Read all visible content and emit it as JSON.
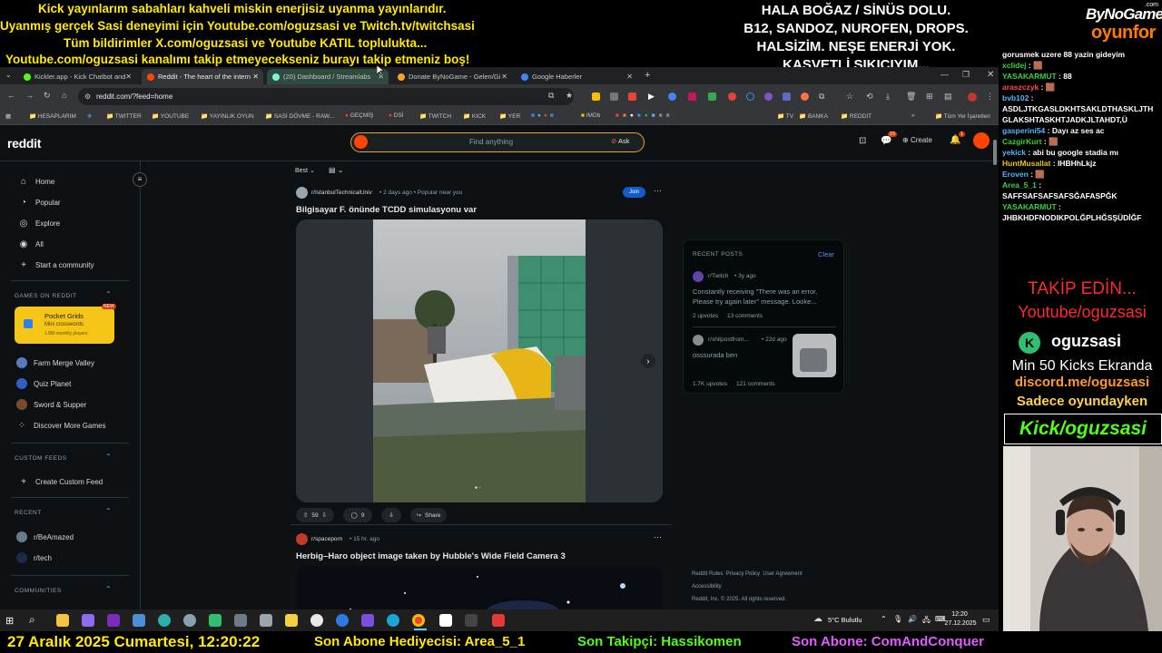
{
  "stream_overlay": {
    "top_lines": [
      "Kick yayınlarım sabahları kahveli miskin enerjisiz uyanma yayınlarıdır.",
      "Uyanmış gerçek Sasi deneyimi için Youtube.com/oguzsasi ve Twitch.tv/twitchsasi",
      "Tüm bildirimler X.com/oguzsasi ve Youtube KATIL toplulukta...",
      "Youtube.com/oguzsasi kanalımı takip etmeyecekseniz burayı takip etmeniz boş!"
    ],
    "status_lines": [
      "HALA BOĞAZ / SİNÜS DOLU.",
      "B12, SANDOZ, NUROFEN, DROPS.",
      "HALSİZİM. NEŞE ENERJİ YOK.",
      "KASVETLİ SIKICIYIM..."
    ],
    "logo_top": "ByNoGame",
    "logo_com": ".com",
    "logo_bottom": "oyunfor",
    "promo": {
      "follow": "TAKİP EDİN...",
      "youtube": "Youtube/oguzsasi",
      "kick_name": "oguzsasi",
      "min_kicks": "Min 50 Kicks Ekranda",
      "discord": "discord.me/oguzsasi",
      "only_game": "Sadece oyundayken",
      "kick_link": "Kick/oguzsasi"
    },
    "ticker": {
      "date": "27 Aralık 2025 Cumartesi, 12:20:22",
      "gift": "Son Abone Hediyecisi: Area_5_1",
      "follower": "Son Takipçi: Hassikomen",
      "subscriber": "Son Abone: ComAndConquer"
    }
  },
  "chat": [
    {
      "user": "",
      "text": "gorusmek uzere 88 yazin gideyim",
      "color": ""
    },
    {
      "user": "xclidej",
      "text": ": 🟫",
      "color": "g"
    },
    {
      "user": "YASAKARMUT",
      "text": ": 88",
      "color": "g"
    },
    {
      "user": "araszczyk",
      "text": ": 🟫",
      "color": "r"
    },
    {
      "user": "bvb102",
      "text": ":",
      "color": "b"
    },
    {
      "user": "",
      "text": "ASDLJTKGASLDKHTSAKLDTHASKLJTH",
      "color": ""
    },
    {
      "user": "",
      "text": "GLAKSHTASKHTJADKJLTAHDT,Ü",
      "color": ""
    },
    {
      "user": "gasperini54",
      "text": ": Dayı az ses ac",
      "color": "b"
    },
    {
      "user": "CazgirKurt",
      "text": ": 🟫",
      "color": "g"
    },
    {
      "user": "yekick",
      "text": ": abi bu google stadia mı",
      "color": "b"
    },
    {
      "user": "HuntMusallat",
      "text": ": IHBHhLkjz",
      "color": "y"
    },
    {
      "user": "Eroven",
      "text": ": 🟫",
      "color": "b"
    },
    {
      "user": "Area_5_1",
      "text": ":",
      "color": "g"
    },
    {
      "user": "",
      "text": "SAFFSAFSAFSAFSĞAFASPĞK",
      "color": ""
    },
    {
      "user": "YASAKARMUT",
      "text": ":",
      "color": "g"
    },
    {
      "user": "",
      "text": "JHBKHDFNODIKPOLĞPLHĞSŞÜDİĞF",
      "color": ""
    }
  ],
  "browser": {
    "tabs": [
      {
        "label": "Kickler.app - Kick Chatbot and",
        "color": "#53fc18"
      },
      {
        "label": "Reddit - The heart of the intern",
        "color": "#ff4500"
      },
      {
        "label": "(20) Dashboard / Streamlabs",
        "color": "#80f5d2"
      },
      {
        "label": "Donate ByNoGame - Gelen/Gi",
        "color": "#f5a623"
      },
      {
        "label": "Google Haberler",
        "color": "#4285f4"
      }
    ],
    "url": "reddit.com/?feed=home",
    "bookmarks": [
      "HESAPLARIM",
      "TWITTER",
      "YOUTUBE",
      "YAYINLIK OYUN",
      "SASİ DÖVME - RAW...",
      "GEÇMİŞ",
      "DSİ",
      "TWITCH",
      "KICK",
      "YER",
      "IMDb",
      "TV",
      "BANKA",
      "REDDIT"
    ],
    "all_bookmarks": "Tüm Yer İşaretleri"
  },
  "reddit": {
    "logo": "reddit",
    "search_placeholder": "Find anything",
    "ask": "Ask",
    "create": "Create",
    "chat_badge": "15",
    "notif_badge": "1",
    "nav": [
      {
        "label": "Home",
        "icon": "home-icon"
      },
      {
        "label": "Popular",
        "icon": "popular-icon"
      },
      {
        "label": "Explore",
        "icon": "explore-icon"
      },
      {
        "label": "All",
        "icon": "all-icon"
      },
      {
        "label": "Start a community",
        "icon": "plus-icon"
      }
    ],
    "games_header": "GAMES ON REDDIT",
    "featured_game": {
      "title": "Pocket Grids",
      "subtitle": "Mini crosswords",
      "players": "1.8M monthly players",
      "badge": "NEW"
    },
    "games": [
      "Farm Merge Valley",
      "Quiz Planet",
      "Sword & Supper",
      "Discover More Games"
    ],
    "custom_header": "CUSTOM FEEDS",
    "custom_item": "Create Custom Feed",
    "recent_header": "RECENT",
    "recent": [
      "r/BeAmazed",
      "r/tech"
    ],
    "communities_header": "COMMUNITIES",
    "sort": "Best",
    "posts": [
      {
        "subreddit": "r/IstanbulTechnicalUniv",
        "meta": "• 2 days ago • Popular near you",
        "title": "Bilgisayar F. önünde TCDD simulasyonu var",
        "join": "Join",
        "votes": "59",
        "comments": "9",
        "share": "Share"
      },
      {
        "subreddit": "r/spaceporn",
        "meta": "• 15 hr. ago",
        "title": "Herbig–Haro object image taken by Hubble's Wide Field Camera 3"
      }
    ],
    "recent_posts": {
      "header": "RECENT POSTS",
      "clear": "Clear",
      "items": [
        {
          "sub": "r/Twitch",
          "age": "• 3y ago",
          "title": "Constantly receiving \"There was an error. Please try again later\" message. Looke...",
          "upvotes": "2 upvotes",
          "comments": "13 comments"
        },
        {
          "sub": "r/shitpostfrom...",
          "age": "• 22d ago",
          "title": "osssurada ben",
          "upvotes": "1.7K upvotes",
          "comments": "121 comments"
        }
      ]
    },
    "footer": {
      "rules": "Reddit Rules",
      "privacy": "Privacy Policy",
      "agreement": "User Agreement",
      "access": "Accessibility",
      "copy": "Reddit, Inc. © 2025. All rights reserved."
    }
  },
  "taskbar": {
    "weather": "5°C Bulutlu",
    "time": "12:20",
    "date": "27.12.2025"
  }
}
